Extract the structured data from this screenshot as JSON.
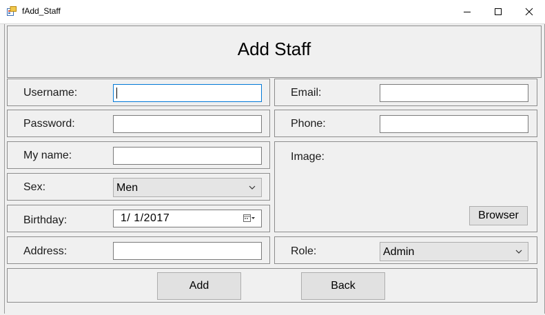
{
  "window": {
    "title": "fAdd_Staff"
  },
  "heading": "Add Staff",
  "form": {
    "username": {
      "label": "Username:",
      "value": ""
    },
    "password": {
      "label": "Password:",
      "value": ""
    },
    "my_name": {
      "label": "My name:",
      "value": ""
    },
    "sex": {
      "label": "Sex:",
      "value": "Men"
    },
    "birthday": {
      "label": "Birthday:",
      "value": "1/  1/2017"
    },
    "address": {
      "label": "Address:",
      "value": ""
    },
    "email": {
      "label": "Email:",
      "value": ""
    },
    "phone": {
      "label": "Phone:",
      "value": ""
    },
    "image": {
      "label": "Image:",
      "browse_label": "Browser"
    },
    "role": {
      "label": "Role:",
      "value": "Admin"
    }
  },
  "actions": {
    "add_label": "Add",
    "back_label": "Back"
  },
  "icons": {
    "app": "form-app-icon",
    "minimize": "minimize-icon",
    "maximize": "maximize-icon",
    "close": "close-icon",
    "dropdown": "chevron-down-icon",
    "calendar": "calendar-icon"
  },
  "colors": {
    "focus_border": "#0078d7",
    "background": "#f0f0f0"
  }
}
